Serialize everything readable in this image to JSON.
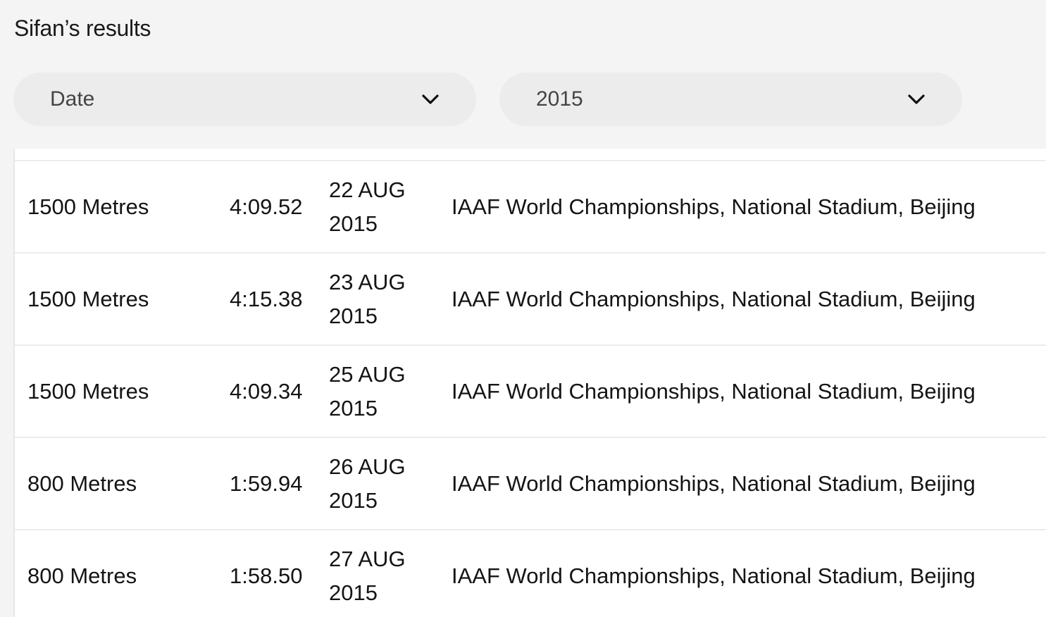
{
  "header": {
    "title": "Sifan’s results"
  },
  "filters": {
    "sort_by": {
      "value": "Date",
      "icon": "chevron-down-icon"
    },
    "year": {
      "value": "2015",
      "icon": "chevron-down-icon"
    }
  },
  "results": [
    {
      "discipline": "1500 Metres",
      "mark": "4:09.52",
      "date_day": "22 AUG",
      "date_year": "2015",
      "competition": "IAAF World Championships, National Stadium, Beijing"
    },
    {
      "discipline": "1500 Metres",
      "mark": "4:15.38",
      "date_day": "23 AUG",
      "date_year": "2015",
      "competition": "IAAF World Championships, National Stadium, Beijing"
    },
    {
      "discipline": "1500 Metres",
      "mark": "4:09.34",
      "date_day": "25 AUG",
      "date_year": "2015",
      "competition": "IAAF World Championships, National Stadium, Beijing"
    },
    {
      "discipline": "800 Metres",
      "mark": "1:59.94",
      "date_day": "26 AUG",
      "date_year": "2015",
      "competition": "IAAF World Championships, National Stadium, Beijing"
    },
    {
      "discipline": "800 Metres",
      "mark": "1:58.50",
      "date_day": "27 AUG",
      "date_year": "2015",
      "competition": "IAAF World Championships, National Stadium, Beijing"
    }
  ],
  "colors": {
    "page_background": "#f4f4f4",
    "panel_background": "#ffffff",
    "pill_background": "#ececec",
    "text_primary": "#141414",
    "text_secondary": "#444444"
  }
}
